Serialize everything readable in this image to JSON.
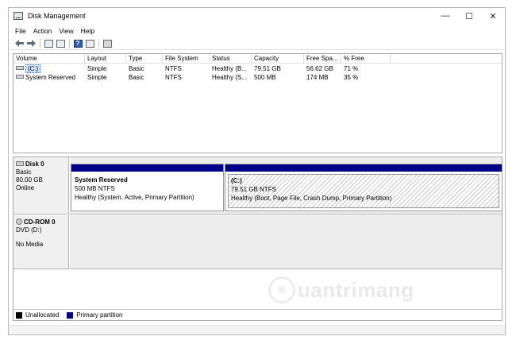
{
  "window": {
    "title": "Disk Management",
    "controls": {
      "minimize": "—",
      "maximize": "☐",
      "close": "✕"
    }
  },
  "menu": [
    "File",
    "Action",
    "View",
    "Help"
  ],
  "toolbar": {
    "back_icon": "arrow-left-icon",
    "forward_icon": "arrow-right-icon",
    "help_glyph": "?"
  },
  "volume_table": {
    "columns": [
      "Volume",
      "Layout",
      "Type",
      "File System",
      "Status",
      "Capacity",
      "Free Spa...",
      "% Free"
    ],
    "rows": [
      {
        "volume": "(C:)",
        "layout": "Simple",
        "type": "Basic",
        "fs": "NTFS",
        "status": "Healthy (B...",
        "capacity": "79.51 GB",
        "free": "56.62 GB",
        "pct": "71 %"
      },
      {
        "volume": "System Reserved",
        "layout": "Simple",
        "type": "Basic",
        "fs": "NTFS",
        "status": "Healthy (S...",
        "capacity": "500 MB",
        "free": "174 MB",
        "pct": "35 %"
      }
    ]
  },
  "disks": [
    {
      "name": "Disk 0",
      "kind": "Basic",
      "size": "80.00 GB",
      "state": "Online",
      "partitions": [
        {
          "name": "System Reserved",
          "size": "500 MB NTFS",
          "status": "Healthy (System, Active, Primary Partition)"
        },
        {
          "name": "(C:)",
          "size": "79.51 GB NTFS",
          "status": "Healthy (Boot, Page File, Crash Dump, Primary Partition)"
        }
      ]
    },
    {
      "name": "CD-ROM 0",
      "kind": "DVD (D:)",
      "state": "No Media"
    }
  ],
  "legend": [
    {
      "label": "Unallocated",
      "color": "#000000"
    },
    {
      "label": "Primary partition",
      "color": "#00008b"
    }
  ],
  "watermark": {
    "text": "uantrimang"
  },
  "colors": {
    "primary_partition": "#00008b",
    "selection": "#d3e3f7"
  }
}
